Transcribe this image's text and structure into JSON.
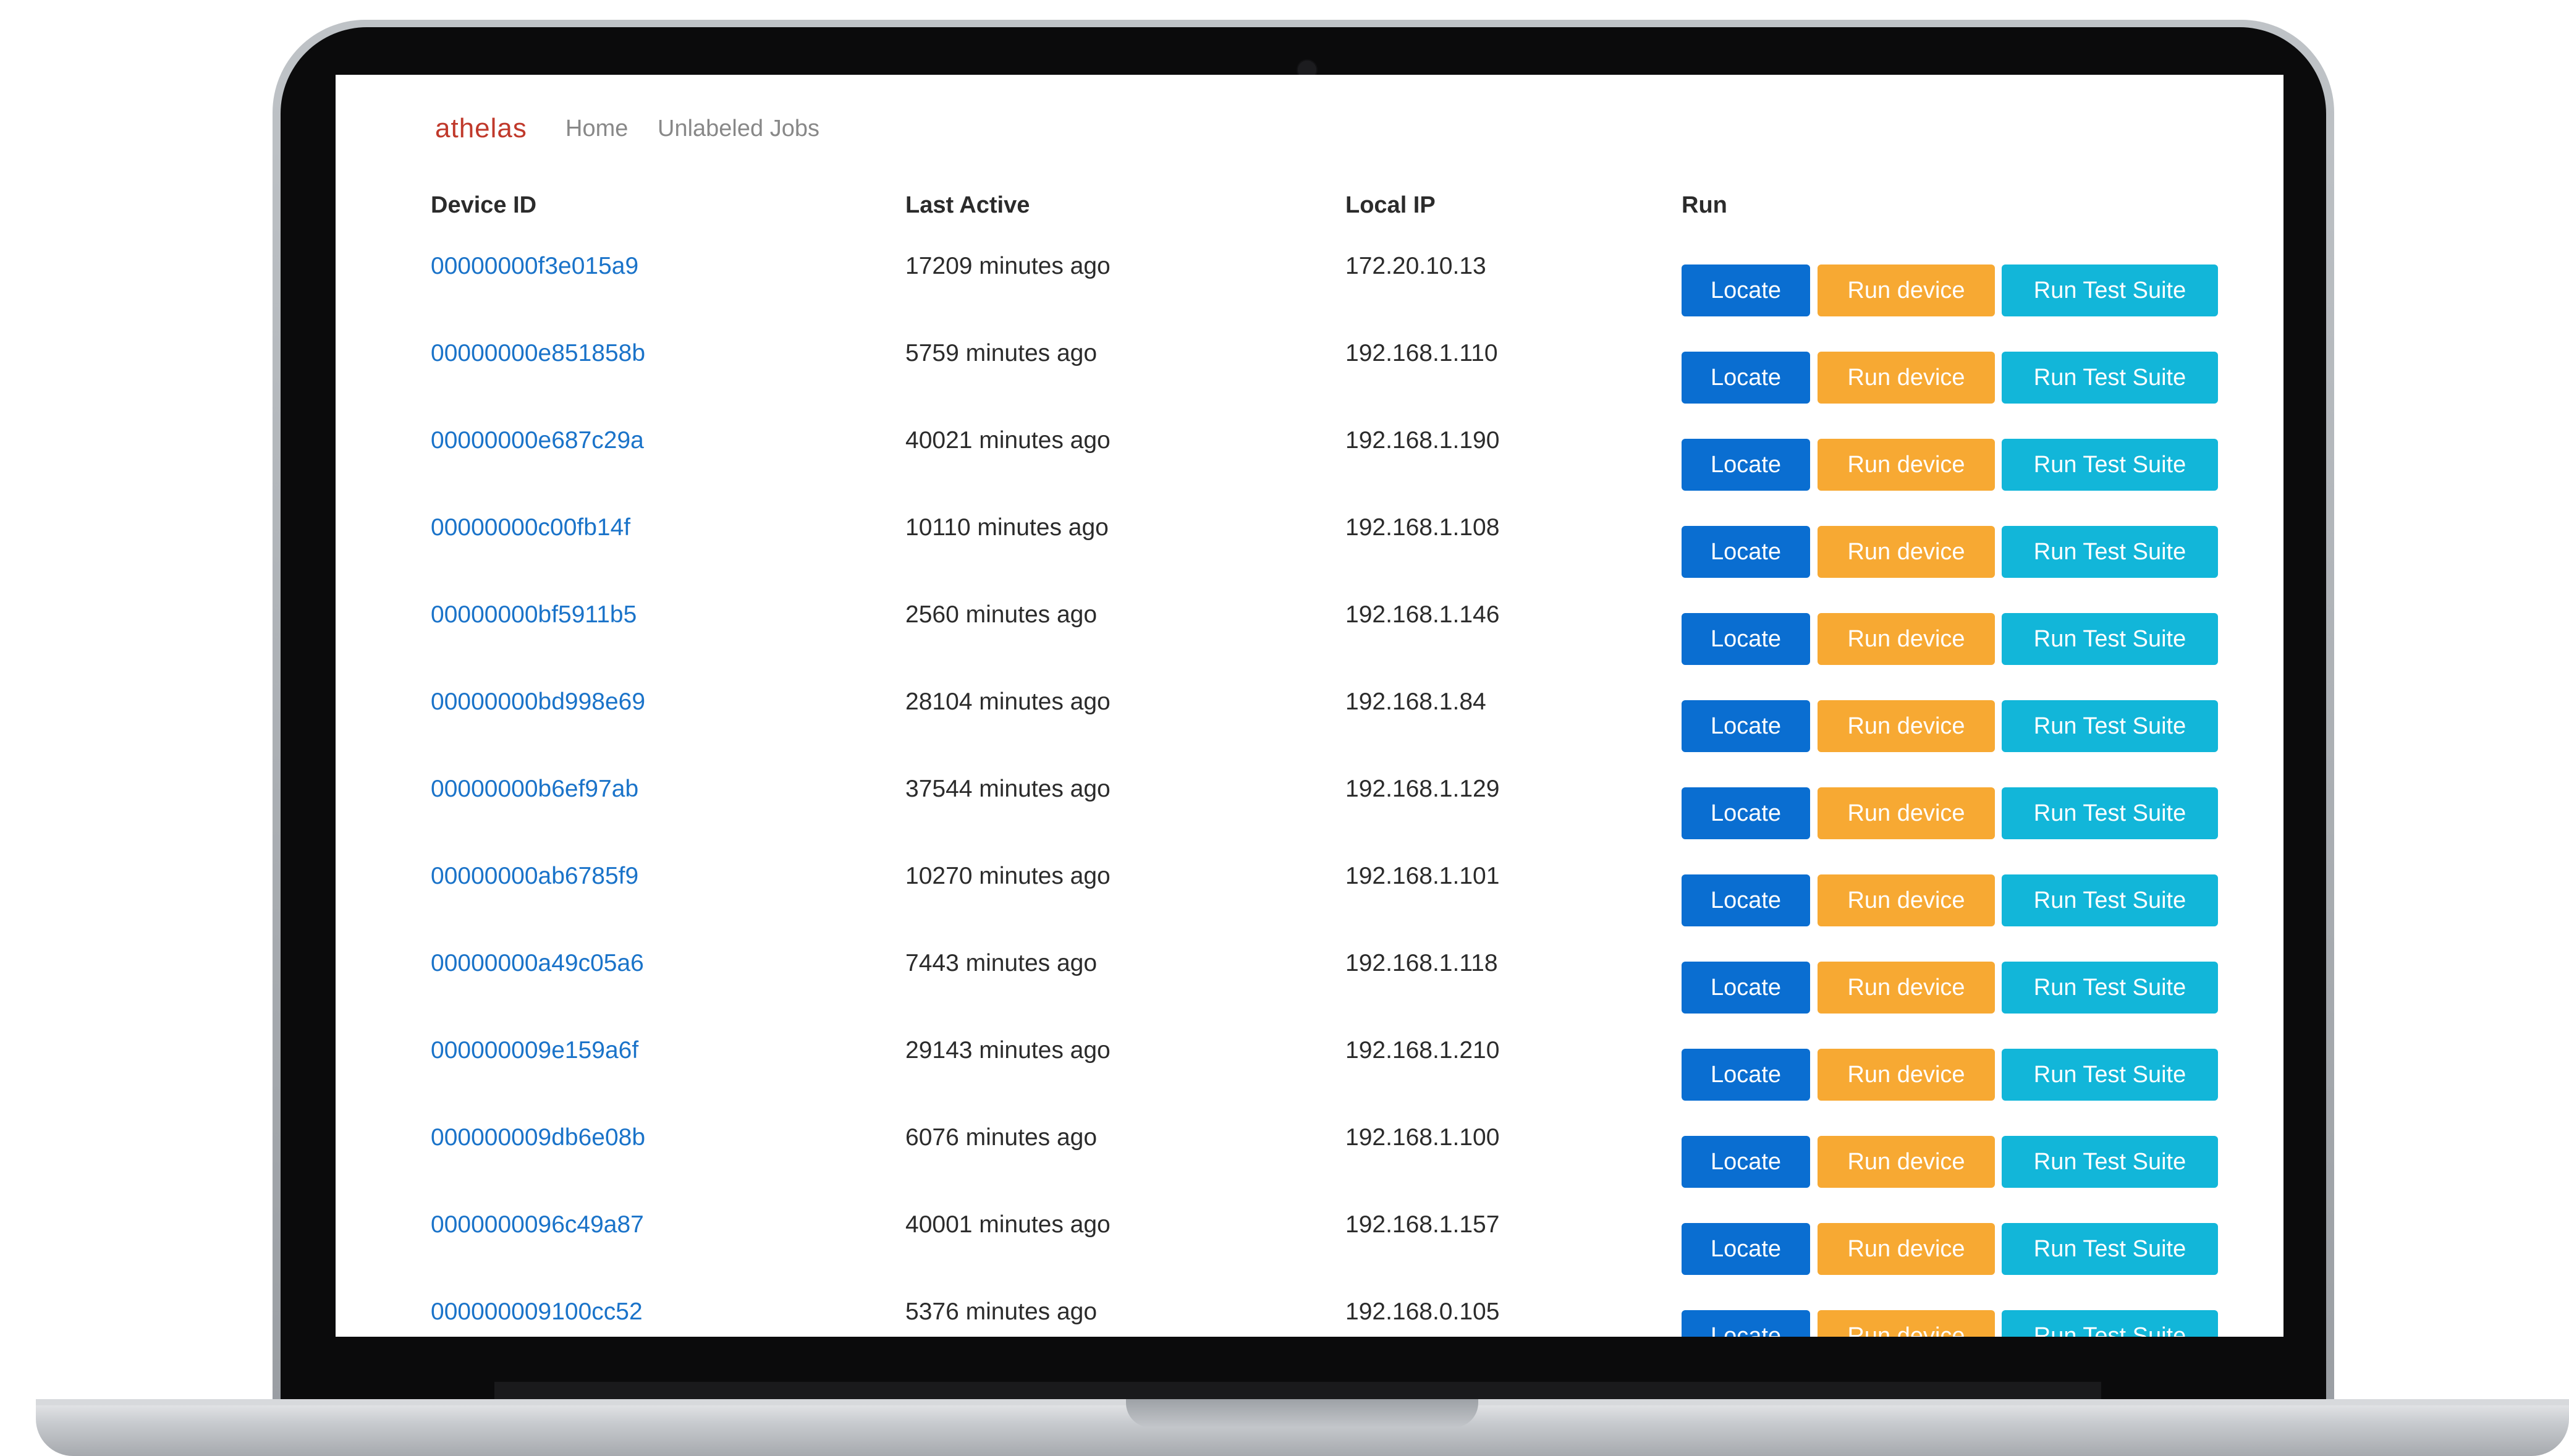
{
  "app": {
    "brand": "athelas",
    "nav": [
      {
        "label": "Home"
      },
      {
        "label": "Unlabeled Jobs"
      }
    ]
  },
  "table": {
    "headers": {
      "device_id": "Device ID",
      "last_active": "Last Active",
      "local_ip": "Local IP",
      "run": "Run"
    },
    "buttons": {
      "locate": "Locate",
      "run_device": "Run device",
      "run_test_suite": "Run Test Suite"
    },
    "rows": [
      {
        "device_id": "00000000f3e015a9",
        "last_active": "17209 minutes ago",
        "local_ip": "172.20.10.13"
      },
      {
        "device_id": "00000000e851858b",
        "last_active": "5759 minutes ago",
        "local_ip": "192.168.1.110"
      },
      {
        "device_id": "00000000e687c29a",
        "last_active": "40021 minutes ago",
        "local_ip": "192.168.1.190"
      },
      {
        "device_id": "00000000c00fb14f",
        "last_active": "10110 minutes ago",
        "local_ip": "192.168.1.108"
      },
      {
        "device_id": "00000000bf5911b5",
        "last_active": "2560 minutes ago",
        "local_ip": "192.168.1.146"
      },
      {
        "device_id": "00000000bd998e69",
        "last_active": "28104 minutes ago",
        "local_ip": "192.168.1.84"
      },
      {
        "device_id": "00000000b6ef97ab",
        "last_active": "37544 minutes ago",
        "local_ip": "192.168.1.129"
      },
      {
        "device_id": "00000000ab6785f9",
        "last_active": "10270 minutes ago",
        "local_ip": "192.168.1.101"
      },
      {
        "device_id": "00000000a49c05a6",
        "last_active": "7443 minutes ago",
        "local_ip": "192.168.1.118"
      },
      {
        "device_id": "000000009e159a6f",
        "last_active": "29143 minutes ago",
        "local_ip": "192.168.1.210"
      },
      {
        "device_id": "000000009db6e08b",
        "last_active": "6076 minutes ago",
        "local_ip": "192.168.1.100"
      },
      {
        "device_id": "0000000096c49a87",
        "last_active": "40001 minutes ago",
        "local_ip": "192.168.1.157"
      },
      {
        "device_id": "000000009100cc52",
        "last_active": "5376 minutes ago",
        "local_ip": "192.168.0.105"
      }
    ]
  },
  "colors": {
    "brand": "#c0392b",
    "link": "#1a73c9",
    "locate": "#0a6ed1",
    "run_device": "#f7a933",
    "run_test_suite": "#12b6d9"
  }
}
